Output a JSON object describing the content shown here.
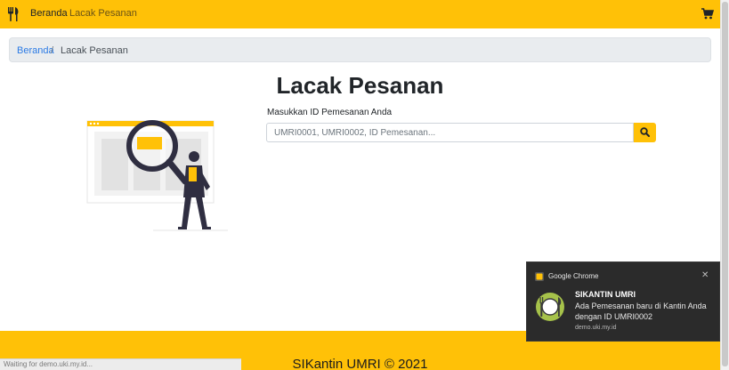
{
  "navbar": {
    "brand_icon": "utensils-icon",
    "links": [
      {
        "label": "Beranda"
      },
      {
        "label": "Lacak Pesanan"
      }
    ],
    "cart_icon": "shopping-cart-icon"
  },
  "breadcrumb": {
    "home": "Beranda",
    "separator": "/",
    "current": "Lacak Pesanan"
  },
  "main": {
    "title": "Lacak Pesanan",
    "form_label": "Masukkan ID Pemesanan Anda",
    "search_placeholder": "UMRI0001, UMRI0002, ID Pemesanan...",
    "search_icon": "search-icon"
  },
  "footer": {
    "text": "SIKantin UMRI © 2021"
  },
  "status_bar": {
    "text": "Waiting for demo.uki.my.id..."
  },
  "notification": {
    "app": "Google Chrome",
    "close": "✕",
    "title": "SIKANTIN UMRI",
    "body": "Ada Pemesanan baru di Kantin Anda dengan ID UMRI0002",
    "site": "demo.uki.my.id"
  },
  "colors": {
    "accent": "#ffc107",
    "link": "#2c7be5",
    "notification_bg": "#2b2b2b"
  }
}
